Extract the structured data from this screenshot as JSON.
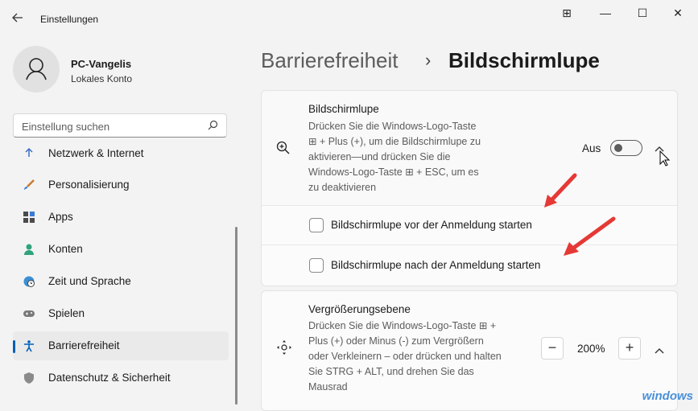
{
  "window": {
    "title": "Einstellungen",
    "controls": {
      "snap": "⊞",
      "minimize": "—",
      "maximize": "☐",
      "close": "✕"
    }
  },
  "profile": {
    "name": "PC-Vangelis",
    "account": "Lokales Konto"
  },
  "search": {
    "placeholder": "Einstellung suchen"
  },
  "nav": {
    "items": [
      {
        "label": "Netzwerk & Internet",
        "icon": "network-icon"
      },
      {
        "label": "Personalisierung",
        "icon": "brush-icon"
      },
      {
        "label": "Apps",
        "icon": "apps-icon"
      },
      {
        "label": "Konten",
        "icon": "person-icon"
      },
      {
        "label": "Zeit und Sprache",
        "icon": "globe-clock-icon"
      },
      {
        "label": "Spielen",
        "icon": "gamepad-icon"
      },
      {
        "label": "Barrierefreiheit",
        "icon": "accessibility-icon",
        "active": true
      },
      {
        "label": "Datenschutz & Sicherheit",
        "icon": "shield-icon"
      }
    ]
  },
  "header": {
    "parent": "Barrierefreiheit",
    "separator": "›",
    "current": "Bildschirmlupe"
  },
  "magnifier": {
    "title": "Bildschirmlupe",
    "desc_lines": [
      "Drücken Sie die Windows-Logo-Taste",
      "⊞ + Plus (+), um die Bildschirmlupe zu",
      "aktivieren—und drücken Sie die",
      "Windows-Logo-Taste ⊞ + ESC, um es",
      "zu deaktivieren"
    ],
    "toggle_label": "Aus",
    "toggle_on": false,
    "options": [
      {
        "label": "Bildschirmlupe vor der Anmeldung starten",
        "checked": false
      },
      {
        "label": "Bildschirmlupe nach der Anmeldung starten",
        "checked": false
      }
    ]
  },
  "zoom": {
    "title": "Vergrößerungsebene",
    "desc_lines": [
      "Drücken Sie die Windows-Logo-Taste ⊞ +",
      "Plus (+) oder Minus (-) zum Vergrößern",
      "oder Verkleinern – oder drücken und halten",
      "Sie STRG + ALT, und drehen Sie das",
      "Mausrad"
    ],
    "value": "200%",
    "minus": "−",
    "plus": "+"
  },
  "watermark": "windows",
  "colors": {
    "accent": "#005fb8",
    "annotation_arrow": "#e53935"
  }
}
